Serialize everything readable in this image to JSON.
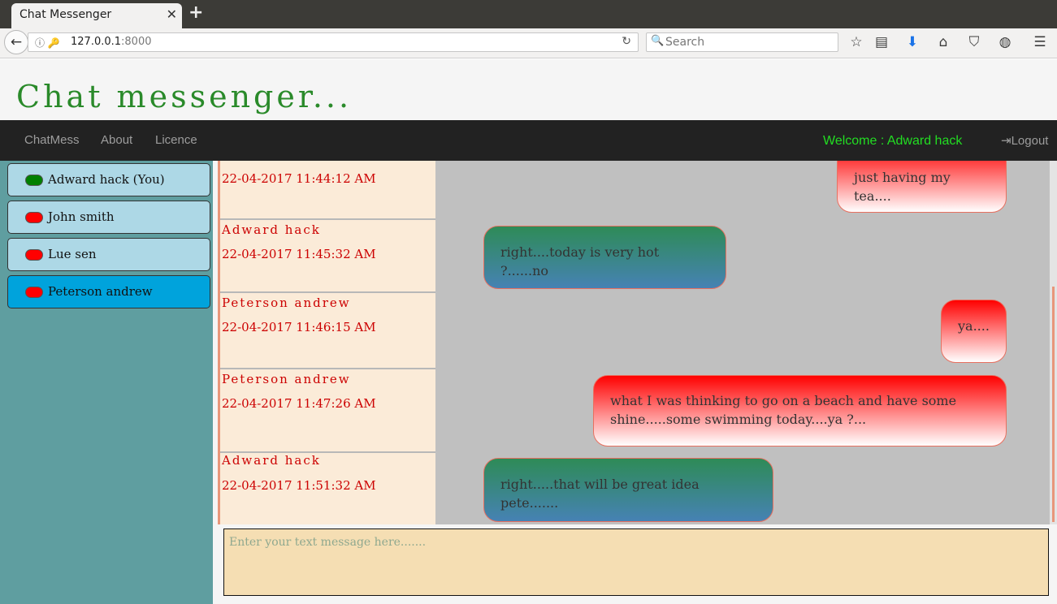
{
  "browser": {
    "tab_title": "Chat Messenger",
    "tab_close": "✕",
    "new_tab": "+",
    "url_host": "127.0.0.1",
    "url_port": ":8000",
    "search_placeholder": "Search"
  },
  "header": {
    "title": "Chat messenger..."
  },
  "nav": {
    "links": [
      "ChatMess",
      "About",
      "Licence"
    ],
    "welcome": "Welcome : Adward hack",
    "logout": "Logout"
  },
  "users": [
    {
      "name": "Adward hack (You)",
      "status": "online",
      "active": false
    },
    {
      "name": "John smith",
      "status": "offline",
      "active": false
    },
    {
      "name": "Lue sen",
      "status": "offline",
      "active": false
    },
    {
      "name": "Peterson andrew",
      "status": "offline",
      "active": true
    }
  ],
  "messages": [
    {
      "sender": "",
      "time": "22-04-2017 11:44:12 AM",
      "text": "just having my tea....",
      "direction": "out"
    },
    {
      "sender": "Adward hack",
      "time": "22-04-2017 11:45:32 AM",
      "text": "right....today is very hot ?......no",
      "direction": "in"
    },
    {
      "sender": "Peterson andrew",
      "time": "22-04-2017 11:46:15 AM",
      "text": "ya....",
      "direction": "out"
    },
    {
      "sender": "Peterson andrew",
      "time": "22-04-2017 11:47:26 AM",
      "text": "what I was thinking to go on a beach and have some shine.....some swimming today....ya ?...",
      "direction": "out"
    },
    {
      "sender": "Adward hack",
      "time": "22-04-2017 11:51:32 AM",
      "text": "right.....that will be great idea pete.......",
      "direction": "in"
    }
  ],
  "composer": {
    "placeholder": "Enter your text message here......."
  },
  "colors": {
    "online": "#008000",
    "offline": "#ff0000",
    "accent_green": "#2a8a2a",
    "sidebar": "#5f9ea0"
  }
}
